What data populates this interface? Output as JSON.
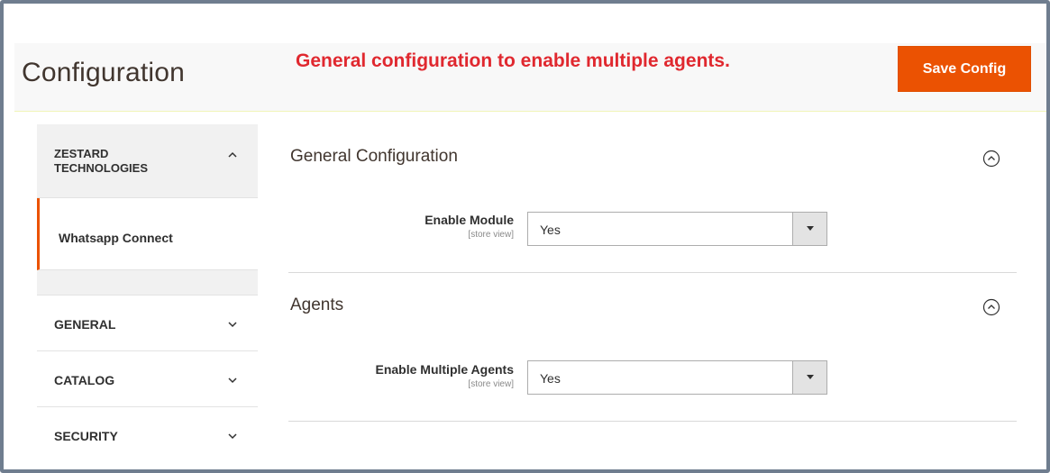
{
  "header": {
    "title": "Configuration",
    "annotation": "General configuration to enable multiple agents.",
    "save_label": "Save Config"
  },
  "sidebar": {
    "group": {
      "title": "ZESTARD TECHNOLOGIES",
      "icon": "chevron-up-icon",
      "items": [
        {
          "label": "Whatsapp Connect",
          "active": true
        }
      ]
    },
    "sections": [
      {
        "label": "GENERAL",
        "icon": "chevron-down-icon"
      },
      {
        "label": "CATALOG",
        "icon": "chevron-down-icon"
      },
      {
        "label": "SECURITY",
        "icon": "chevron-down-icon"
      }
    ]
  },
  "main": {
    "sections": [
      {
        "title": "General Configuration",
        "icon": "collapse-circle-icon",
        "field": {
          "label": "Enable Module",
          "scope": "[store view]",
          "value": "Yes"
        }
      },
      {
        "title": "Agents",
        "icon": "collapse-circle-icon",
        "field": {
          "label": "Enable Multiple Agents",
          "scope": "[store view]",
          "value": "Yes"
        }
      }
    ]
  },
  "colors": {
    "accent": "#eb5202",
    "annotation": "#e0282f",
    "frame": "#6f7d8f"
  }
}
